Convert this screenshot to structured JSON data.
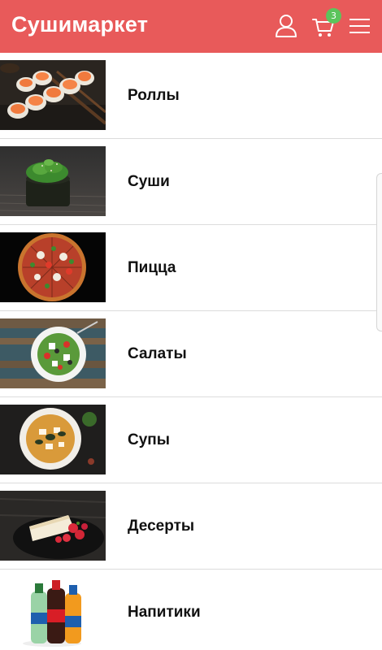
{
  "header": {
    "brand": "Сушимаркет",
    "cart_count": "3",
    "colors": {
      "bar": "#e85a5a",
      "badge": "#5cc45c"
    },
    "icons": [
      "user-icon",
      "cart-icon",
      "menu-icon"
    ]
  },
  "categories": [
    {
      "label": "Роллы",
      "image": "rolls-photo"
    },
    {
      "label": "Суши",
      "image": "sushi-photo"
    },
    {
      "label": "Пицца",
      "image": "pizza-photo"
    },
    {
      "label": "Салаты",
      "image": "salad-photo"
    },
    {
      "label": "Супы",
      "image": "soup-photo"
    },
    {
      "label": "Десерты",
      "image": "dessert-photo"
    },
    {
      "label": "Напитики",
      "image": "drinks-photo"
    }
  ]
}
